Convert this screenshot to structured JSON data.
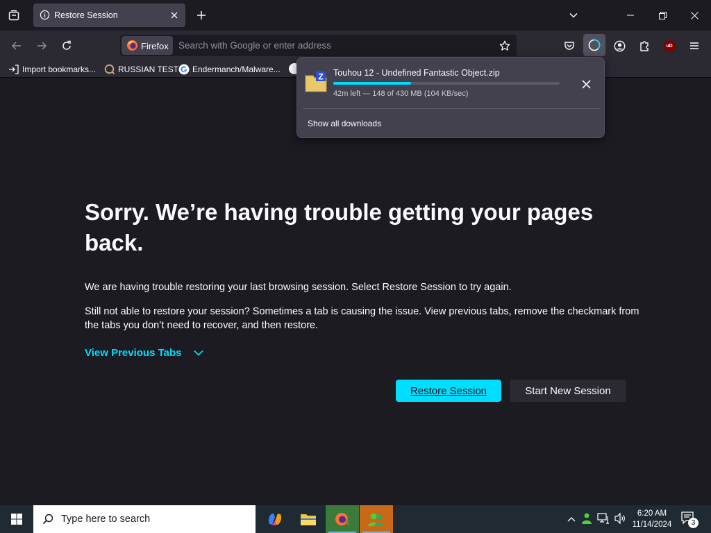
{
  "tab": {
    "title": "Restore Session"
  },
  "urlbar": {
    "identity_label": "Firefox",
    "placeholder": "Search with Google or enter address"
  },
  "bookmarks": [
    {
      "label": "Import bookmarks..."
    },
    {
      "label": "RUSSIAN TEST"
    },
    {
      "label": "Endermanch/Malware..."
    }
  ],
  "download": {
    "filename": "Touhou 12 - Undefined Fantastic Object.zip",
    "status": "42m left — 148 of 430 MB (104 KB/sec)",
    "progress_fraction": 0.344,
    "show_all_label": "Show all downloads",
    "file_badge": "Z"
  },
  "page": {
    "heading": "Sorry. We’re having trouble getting your pages back.",
    "para1": "We are having trouble restoring your last browsing session. Select Restore Session to try again.",
    "para2": "Still not able to restore your session? Sometimes a tab is causing the issue. View previous tabs, remove the checkmark from the tabs you don’t need to recover, and then restore.",
    "view_previous_tabs": "View Previous Tabs",
    "restore_button": "Restore Session",
    "new_session_button": "Start New Session"
  },
  "extension_badge": "uD",
  "taskbar": {
    "search_placeholder": "Type here to search",
    "time": "6:20 AM",
    "date": "11/14/2024",
    "notification_count": "3"
  },
  "colors": {
    "accent": "#00ddff",
    "page_bg": "#1c1b22",
    "toolbar_bg": "#2b2a33",
    "panel_bg": "#42414d",
    "taskbar_bg": "#1f2a33"
  }
}
